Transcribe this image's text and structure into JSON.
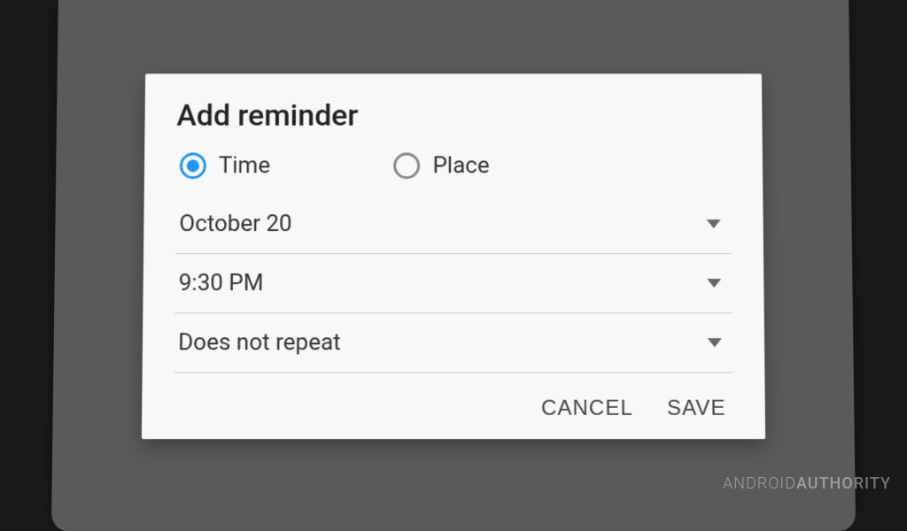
{
  "dialog": {
    "title": "Add reminder",
    "radio": {
      "time_label": "Time",
      "place_label": "Place"
    },
    "dropdowns": {
      "date": "October 20",
      "time": "9:30 PM",
      "repeat": "Does not repeat"
    },
    "buttons": {
      "cancel": "CANCEL",
      "save": "SAVE"
    }
  },
  "watermark": {
    "brand1": "ANDROID",
    "brand2": "AUTHORITY"
  }
}
